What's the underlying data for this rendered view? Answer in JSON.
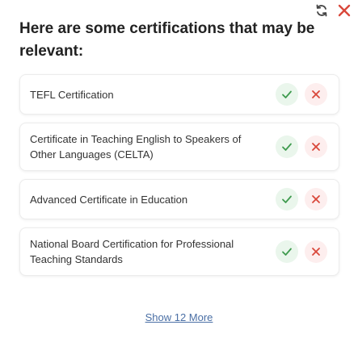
{
  "header": {
    "title": "Here are some certifications that may be relevant:",
    "refresh_icon": "refresh-icon",
    "close_icon": "close-icon"
  },
  "certifications": [
    {
      "label": "TEFL Certification"
    },
    {
      "label": "Certificate in Teaching English to Speakers of Other Languages (CELTA)"
    },
    {
      "label": "Advanced Certificate in Education"
    },
    {
      "label": "National Board Certification for Professional Teaching Standards"
    }
  ],
  "actions": {
    "accept_icon": "check-icon",
    "reject_icon": "x-icon"
  },
  "footer": {
    "show_more_label": "Show 12 More"
  },
  "colors": {
    "accept": "#3f9b4f",
    "accept_bg": "#eaf6ec",
    "reject": "#d9483b",
    "reject_bg": "#fdeeee",
    "link": "#4a6fa5",
    "close": "#d9483b"
  }
}
